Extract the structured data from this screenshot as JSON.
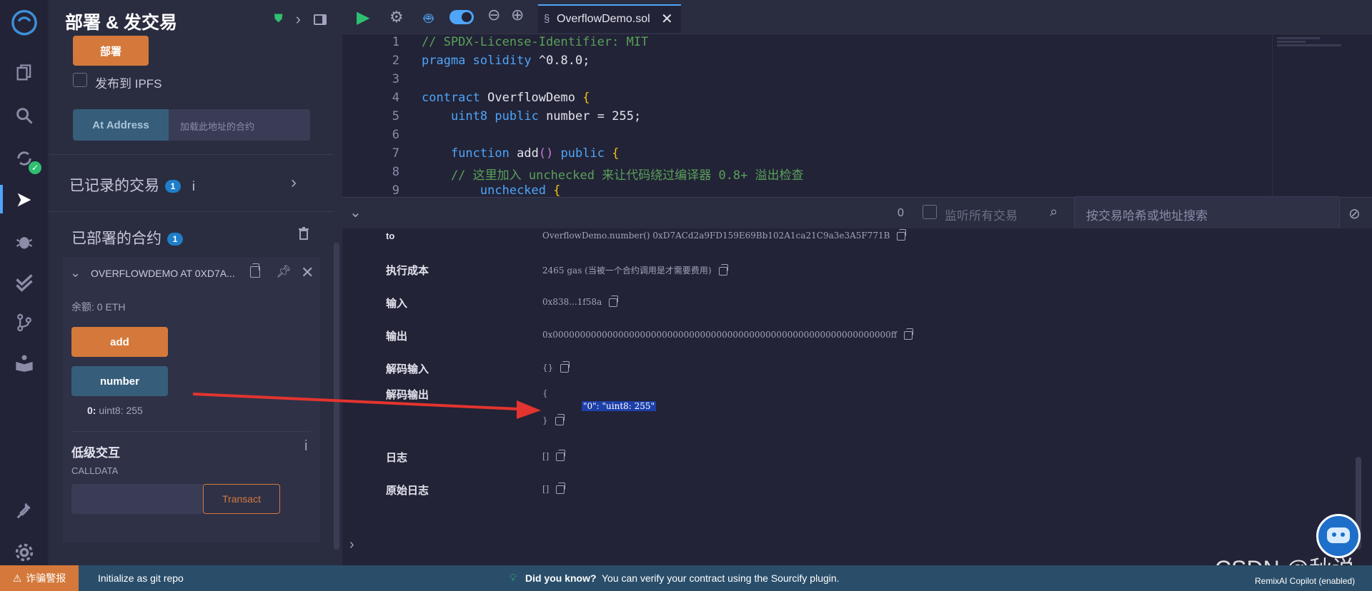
{
  "panel": {
    "title": "部署 & 发交易",
    "deploy_button": "部署",
    "publish_ipfs_label": "发布到 IPFS",
    "at_address_button": "At Address",
    "at_address_placeholder": "加载此地址的合约",
    "recorded_tx_label": "已记录的交易",
    "recorded_tx_count": "1",
    "deployed_label": "已部署的合约",
    "deployed_count": "1",
    "contract_instance": {
      "name": "OVERFLOWDEMO AT 0XD7A...",
      "balance": "余额: 0 ETH",
      "add_button": "add",
      "number_button": "number",
      "result_index": "0:",
      "result_value": "uint8: 255",
      "low_level_title": "低级交互",
      "calldata_label": "CALLDATA",
      "transact_button": "Transact"
    }
  },
  "editor": {
    "tab_name": "OverflowDemo.sol",
    "lines": [
      {
        "n": "1",
        "text": "// SPDX-License-Identifier: MIT"
      },
      {
        "n": "2",
        "text": "pragma solidity ^0.8.0;"
      },
      {
        "n": "3",
        "text": ""
      },
      {
        "n": "4",
        "text": "contract OverflowDemo {"
      },
      {
        "n": "5",
        "text": "    uint8 public number = 255;"
      },
      {
        "n": "6",
        "text": ""
      },
      {
        "n": "7",
        "text": "    function add() public {"
      },
      {
        "n": "8",
        "text": "    // 这里加入 unchecked 来让代码绕过编译器 0.8+ 溢出检查"
      },
      {
        "n": "9",
        "text": "        unchecked {"
      }
    ]
  },
  "terminal": {
    "pending_count": "0",
    "listen_all_label": "监听所有交易",
    "search_placeholder": "按交易哈希或地址搜索",
    "rows": {
      "to_label": "to",
      "to_value": "OverflowDemo.number() 0xD7ACd2a9FD159E69Bb102A1ca21C9a3e3A5F771B",
      "cost_label": "执行成本",
      "cost_value": "2465 gas (当被一个合约调用是才需要费用)",
      "input_label": "输入",
      "input_value": "0x838...1f58a",
      "output_label": "输出",
      "output_value": "0x00000000000000000000000000000000000000000000000000000000000000ff",
      "decoded_input_label": "解码输入",
      "decoded_input_value": "{}",
      "decoded_output_label": "解码输出",
      "decoded_output_open": "{",
      "decoded_output_highlight": "\"0\": \"uint8: 255\"",
      "decoded_output_close": "}",
      "logs_label": "日志",
      "logs_value": "[]",
      "raw_logs_label": "原始日志",
      "raw_logs_value": "[]"
    }
  },
  "statusbar": {
    "scam_alert": "诈骗警报",
    "git_init": "Initialize as git repo",
    "did_you_know": "Did you know?",
    "tip": "You can verify your contract using the Sourcify plugin.",
    "copilot": "RemixAI Copilot (enabled)"
  },
  "watermark": "CSDN @秋说",
  "colors": {
    "accent": "#4ea5f9",
    "orange": "#d4793b",
    "blue_button": "#365e7b",
    "success": "#2fbf71",
    "arrow": "#e3342f"
  }
}
